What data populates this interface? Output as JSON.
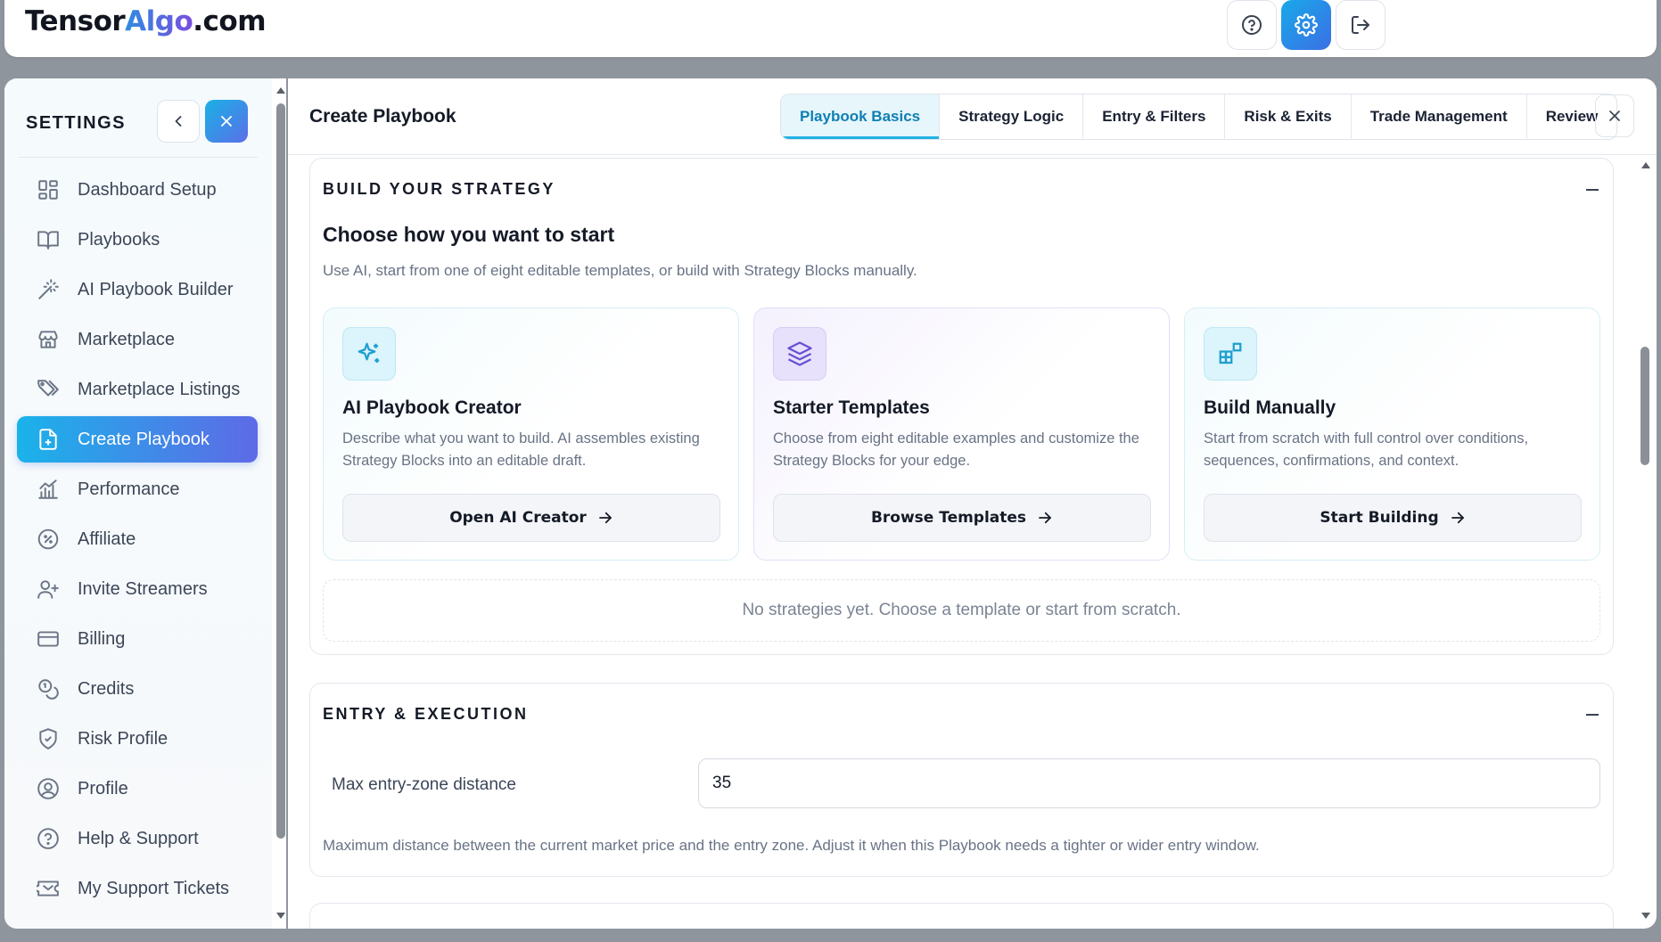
{
  "app": {
    "logo_prefix": "Tensor",
    "logo_accent": "Algo",
    "logo_suffix": ".com",
    "accent_gradient": [
      "#18a9e8",
      "#5e6ae6"
    ]
  },
  "topbar": {
    "buttons": [
      {
        "name": "help",
        "icon": "help-circle-icon"
      },
      {
        "name": "settings",
        "icon": "gear-icon",
        "active": true
      },
      {
        "name": "logout",
        "icon": "logout-icon"
      }
    ]
  },
  "sidebar": {
    "title": "SETTINGS",
    "items": [
      {
        "label": "Dashboard Setup",
        "icon": "dashboard-icon"
      },
      {
        "label": "Playbooks",
        "icon": "book-icon"
      },
      {
        "label": "AI Playbook Builder",
        "icon": "magic-wand-icon"
      },
      {
        "label": "Marketplace",
        "icon": "store-icon"
      },
      {
        "label": "Marketplace Listings",
        "icon": "tags-icon"
      },
      {
        "label": "Create Playbook",
        "icon": "file-plus-icon",
        "active": true
      },
      {
        "label": "Performance",
        "icon": "chart-icon"
      },
      {
        "label": "Affiliate",
        "icon": "badge-percent-icon"
      },
      {
        "label": "Invite Streamers",
        "icon": "user-plus-icon"
      },
      {
        "label": "Billing",
        "icon": "credit-card-icon"
      },
      {
        "label": "Credits",
        "icon": "coins-icon"
      },
      {
        "label": "Risk Profile",
        "icon": "shield-icon"
      },
      {
        "label": "Profile",
        "icon": "user-circle-icon"
      },
      {
        "label": "Help & Support",
        "icon": "help-circle-icon"
      },
      {
        "label": "My Support Tickets",
        "icon": "ticket-icon"
      }
    ]
  },
  "main": {
    "title": "Create Playbook",
    "tabs": [
      {
        "label": "Playbook Basics",
        "active": true
      },
      {
        "label": "Strategy Logic"
      },
      {
        "label": "Entry & Filters"
      },
      {
        "label": "Risk & Exits"
      },
      {
        "label": "Trade Management"
      },
      {
        "label": "Review"
      }
    ]
  },
  "build_section": {
    "title": "BUILD YOUR STRATEGY",
    "heading": "Choose how you want to start",
    "subtitle": "Use AI, start from one of eight editable templates, or build with Strategy Blocks manually.",
    "cards": [
      {
        "icon": "sparkles-icon",
        "title": "AI Playbook Creator",
        "desc": "Describe what you want to build. AI assembles existing Strategy Blocks into an editable draft.",
        "button": "Open AI Creator"
      },
      {
        "icon": "layers-icon",
        "title": "Starter Templates",
        "desc": "Choose from eight editable examples and customize the Strategy Blocks for your edge.",
        "button": "Browse Templates"
      },
      {
        "icon": "blocks-icon",
        "title": "Build Manually",
        "desc": "Start from scratch with full control over conditions, sequences, confirmations, and context.",
        "button": "Start Building"
      }
    ],
    "empty_text": "No strategies yet. Choose a template or start from scratch."
  },
  "entry_section": {
    "title": "ENTRY & EXECUTION",
    "field_label": "Max entry-zone distance",
    "field_value": "35",
    "help": "Maximum distance between the current market price and the entry zone. Adjust it when this Playbook needs a tighter or wider entry window."
  }
}
